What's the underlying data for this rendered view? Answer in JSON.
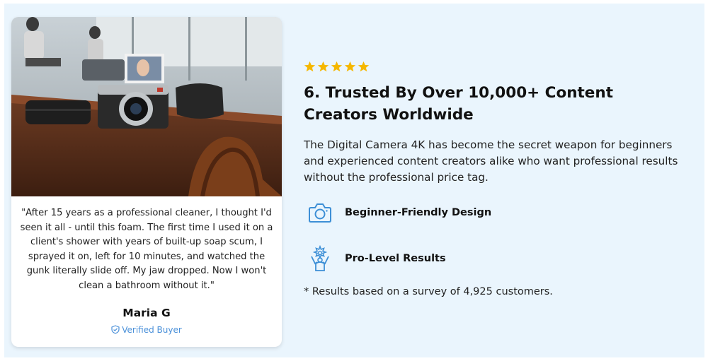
{
  "testimonial": {
    "quote": "\"After 15 years as a professional cleaner, I thought I'd seen it all - until this foam. The first time I used it on a client's shower with years of built-up soap scum, I sprayed it on, left for 10 minutes, and watched the gunk literally slide off. My jaw dropped. Now I won't clean a bathroom without it.\"",
    "author": "Maria G",
    "badge": "Verified Buyer"
  },
  "rating": {
    "stars": 5,
    "color": "#f5b700"
  },
  "headline": "6. Trusted By Over 10,000+ Content Creators Worldwide",
  "description": "The Digital Camera 4K has become the secret weapon for beginners and experienced content creators alike who want professional results without the professional price tag.",
  "features": [
    {
      "icon": "camera-icon",
      "label": "Beginner-Friendly Design"
    },
    {
      "icon": "achievement-person-icon",
      "label": "Pro-Level Results"
    }
  ],
  "note": "* Results based on a survey of 4,925 customers.",
  "colors": {
    "background": "#eaf5fd",
    "accent": "#3d8fd6",
    "verified": "#4a90d9"
  }
}
